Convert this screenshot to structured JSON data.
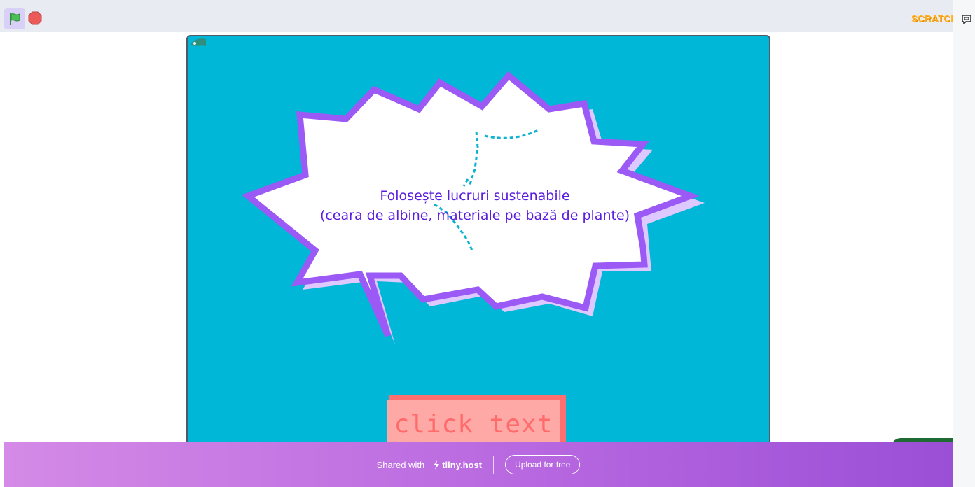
{
  "toolbar": {
    "flag_icon": "green-flag-icon",
    "stop_icon": "stop-icon",
    "logo_text": "SCRATCH",
    "feedback_icon": "feedback-icon"
  },
  "stage": {
    "message_line1": "Folosește lucruri sustenabile",
    "message_line2": "(ceara de albine, materiale pe bază de plante)",
    "button_label": "click text"
  },
  "banner": {
    "shared_with": "Shared with",
    "brand": "tiiny.host",
    "upload_label": "Upload for free"
  },
  "colors": {
    "stage_bg": "#00b7d8",
    "bubble_outline": "#9b59f5",
    "bubble_shadow": "#ddc9ff",
    "text": "#5a1de0",
    "button_face": "#ffa9a6",
    "button_shadow": "#ff6f6f"
  }
}
